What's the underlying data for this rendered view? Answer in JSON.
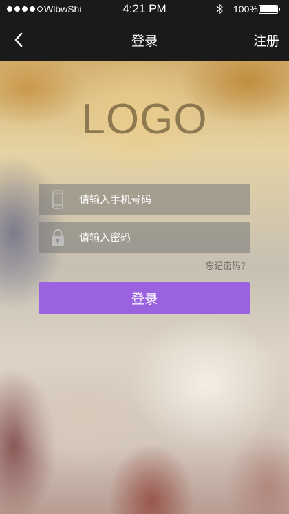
{
  "status_bar": {
    "carrier": "WlbwShi",
    "time": "4:21 PM",
    "battery_percent": "100%",
    "battery_level": 1.0,
    "signal_dots_filled": 4,
    "signal_dots_total": 5,
    "bluetooth_icon": "bluetooth-icon"
  },
  "nav": {
    "back_icon": "chevron-left-icon",
    "title": "登录",
    "register_label": "注册"
  },
  "logo_text": "LOGO",
  "form": {
    "phone": {
      "placeholder": "请输入手机号码",
      "value": "",
      "icon": "phone-icon"
    },
    "password": {
      "placeholder": "请输入密码",
      "value": "",
      "icon": "lock-icon"
    },
    "forgot_label": "忘记密码？",
    "login_label": "登录"
  },
  "colors": {
    "accent": "#9b62e0",
    "bar_background": "#1a1a1a"
  }
}
